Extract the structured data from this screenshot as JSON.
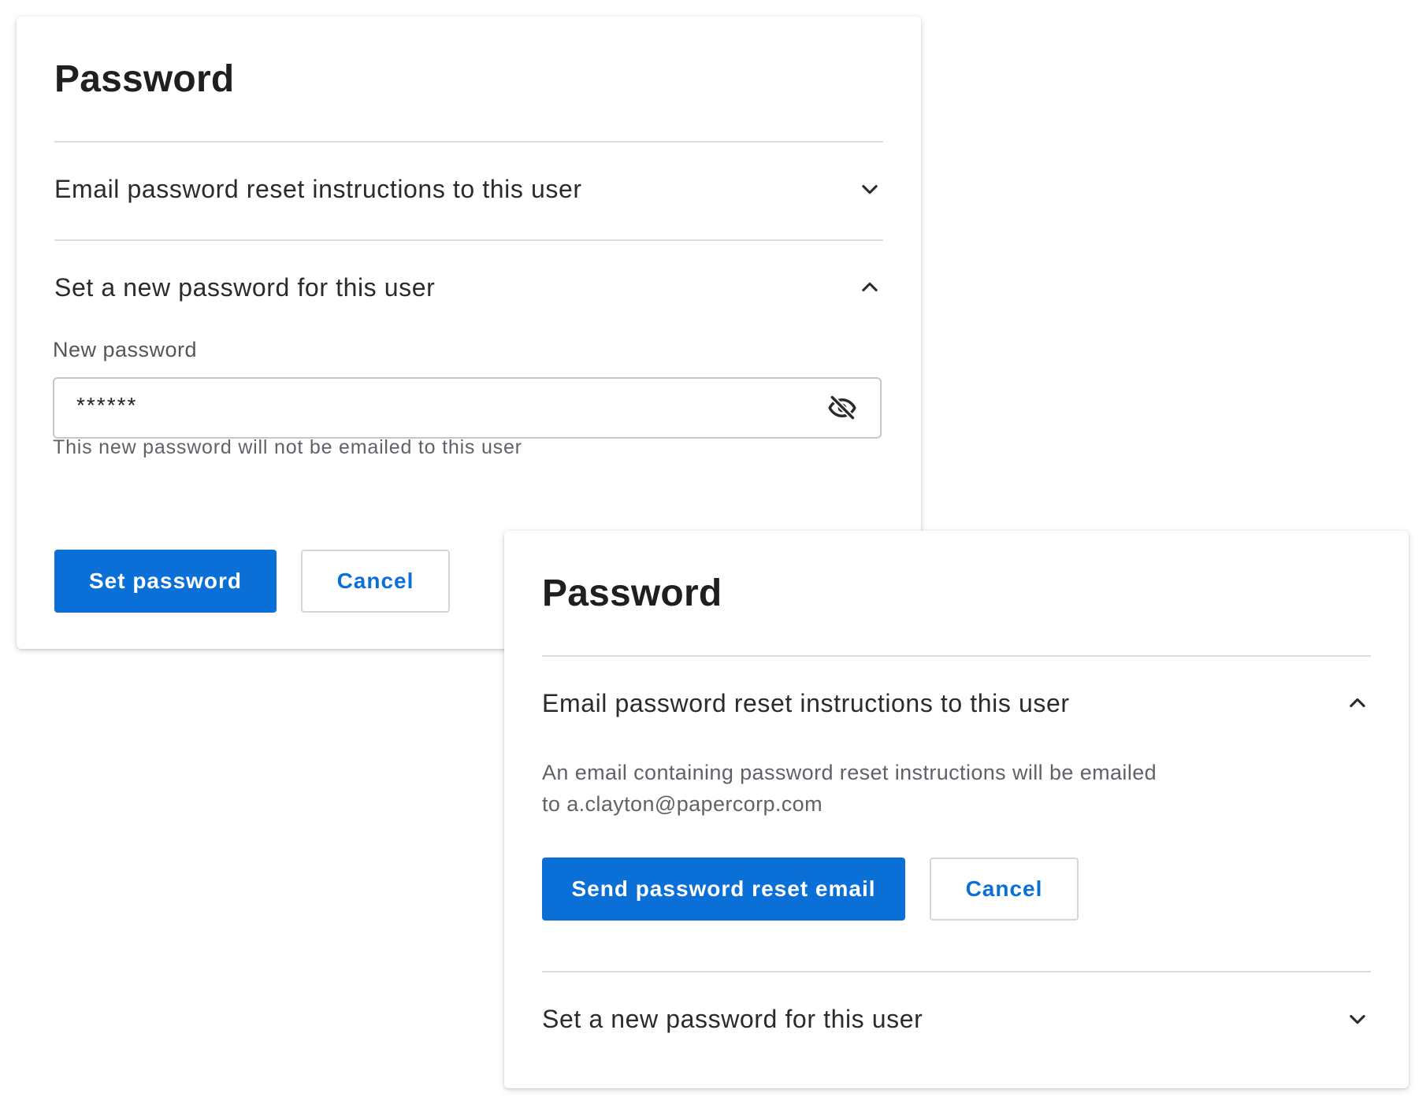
{
  "colors": {
    "primary": "#0b6fd8",
    "divider": "#dcdcdc",
    "text": "#2b2b2b",
    "muted": "#5f6368"
  },
  "card_set_password": {
    "title": "Password",
    "email_section": {
      "label": "Email password reset instructions to this user",
      "state": "collapsed",
      "icon": "chevron-down-icon"
    },
    "set_section": {
      "label": "Set a new password for this user",
      "state": "expanded",
      "icon": "chevron-up-icon"
    },
    "new_password": {
      "label": "New password",
      "value": "******",
      "toggle_icon": "eye-off-icon",
      "helper": "This new password will not be emailed to this user"
    },
    "primary_button": "Set password",
    "cancel_button": "Cancel"
  },
  "card_reset_email": {
    "title": "Password",
    "email_section": {
      "label": "Email password reset instructions to this user",
      "state": "expanded",
      "icon": "chevron-up-icon"
    },
    "description_line1": "An email containing password reset instructions will be emailed",
    "description_line2": "to a.clayton@papercorp.com",
    "primary_button": "Send password reset email",
    "cancel_button": "Cancel",
    "set_section": {
      "label": "Set a new password for this user",
      "state": "collapsed",
      "icon": "chevron-down-icon"
    }
  }
}
